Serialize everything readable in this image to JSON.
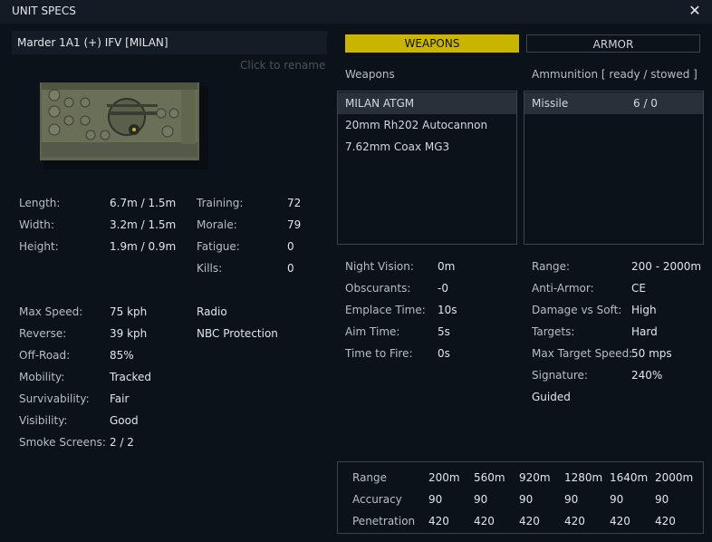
{
  "window": {
    "title": "UNIT SPECS",
    "close_icon": "close-icon"
  },
  "unit": {
    "name": "Marder 1A1 (+) IFV [MILAN]",
    "rename_hint": "Click to rename"
  },
  "dimensions": [
    {
      "label": "Length:",
      "value": "6.7m / 1.5m"
    },
    {
      "label": "Width:",
      "value": "3.2m / 1.5m"
    },
    {
      "label": "Height:",
      "value": "1.9m / 0.9m"
    }
  ],
  "crew": [
    {
      "label": "Training:",
      "value": "72"
    },
    {
      "label": "Morale:",
      "value": "79"
    },
    {
      "label": "Fatigue:",
      "value": "0"
    },
    {
      "label": "Kills:",
      "value": "0"
    }
  ],
  "movement": [
    {
      "label": "Max Speed:",
      "value": "75 kph"
    },
    {
      "label": "Reverse:",
      "value": "39 kph"
    },
    {
      "label": "Off-Road:",
      "value": "85%"
    },
    {
      "label": "Mobility:",
      "value": "Tracked"
    },
    {
      "label": "Survivability:",
      "value": "Fair"
    },
    {
      "label": "Visibility:",
      "value": "Good"
    },
    {
      "label": "Smoke Screens:",
      "value": "2 / 2"
    }
  ],
  "features": [
    "Radio",
    "NBC Protection"
  ],
  "tabs": {
    "weapons": "WEAPONS",
    "armor": "ARMOR"
  },
  "weapons": {
    "header": "Weapons",
    "items": [
      "MILAN ATGM",
      "20mm Rh202 Autocannon",
      "7.62mm Coax MG3"
    ]
  },
  "ammunition": {
    "header": "Ammunition [ ready / stowed ]",
    "items": [
      {
        "name": "Missile",
        "count": "6 / 0"
      }
    ]
  },
  "weapon_stats_left": [
    {
      "label": "Night Vision:",
      "value": "0m"
    },
    {
      "label": "Obscurants:",
      "value": "-0"
    },
    {
      "label": "Emplace Time:",
      "value": "10s"
    },
    {
      "label": "Aim Time:",
      "value": "5s"
    },
    {
      "label": "Time to Fire:",
      "value": "0s"
    }
  ],
  "weapon_stats_right": [
    {
      "label": "Range:",
      "value": "200 - 2000m"
    },
    {
      "label": "Anti-Armor:",
      "value": "CE"
    },
    {
      "label": "Damage vs Soft:",
      "value": "High"
    },
    {
      "label": "Targets:",
      "value": "Hard"
    },
    {
      "label": "Max Target Speed:",
      "value": "50 mps"
    },
    {
      "label": "Signature:",
      "value": "240%"
    }
  ],
  "weapon_tags": [
    "Guided"
  ],
  "range_table": {
    "rows": [
      {
        "label": "Range",
        "values": [
          "200m",
          "560m",
          "920m",
          "1280m",
          "1640m",
          "2000m"
        ]
      },
      {
        "label": "Accuracy",
        "values": [
          "90",
          "90",
          "90",
          "90",
          "90",
          "90"
        ]
      },
      {
        "label": "Penetration",
        "values": [
          "420",
          "420",
          "420",
          "420",
          "420",
          "420"
        ]
      }
    ]
  },
  "colors": {
    "background": "#0b1219",
    "titlebar": "#131b24",
    "accent_tab": "#c9b402",
    "border": "#3b434b",
    "selected_row": "#28303a"
  }
}
